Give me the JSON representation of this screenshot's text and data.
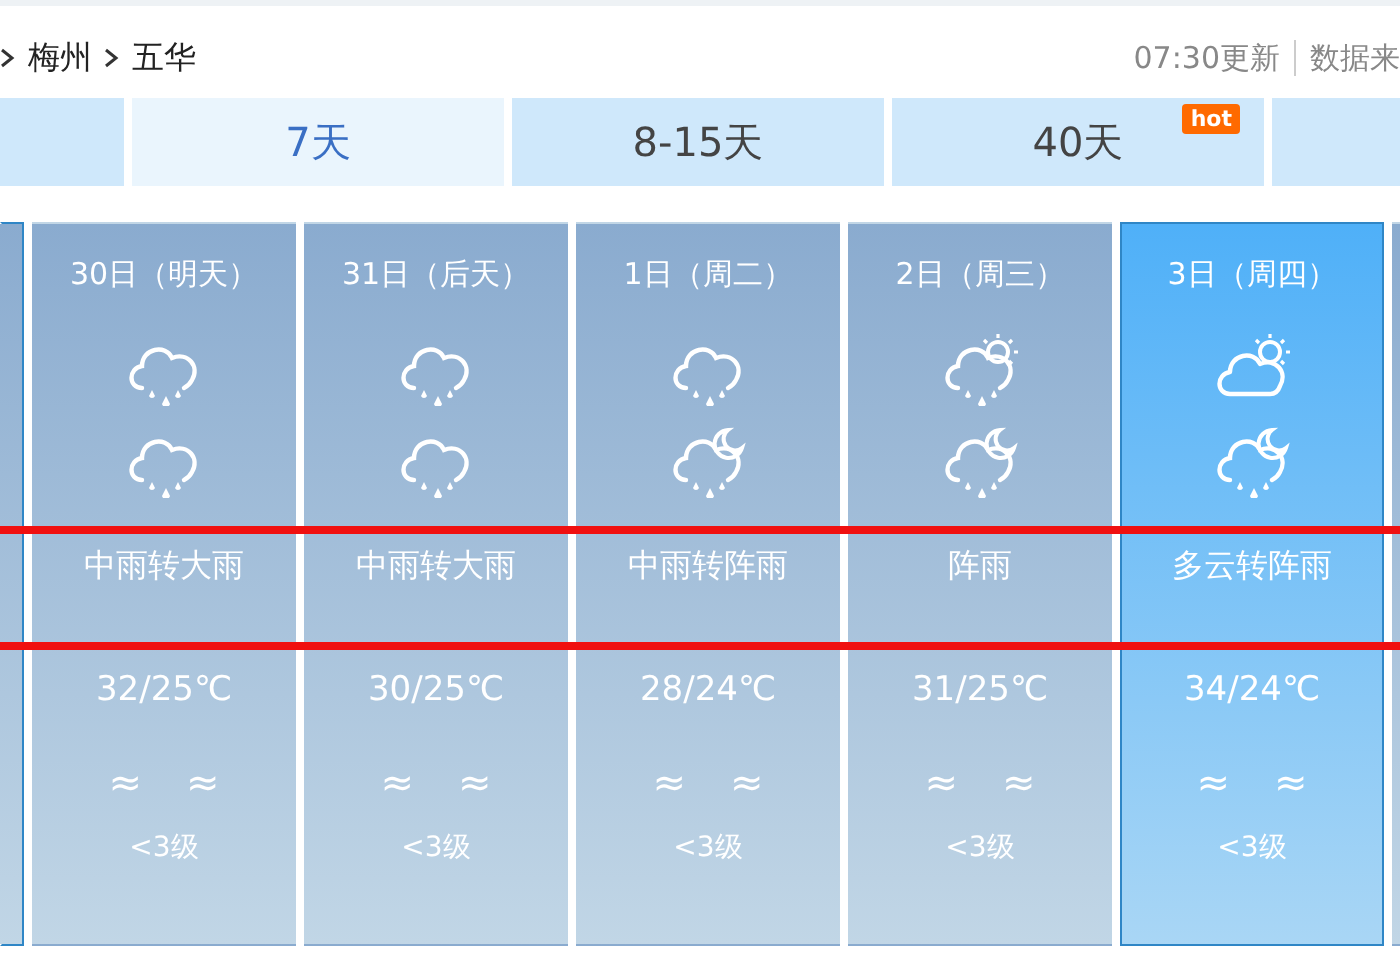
{
  "breadcrumb": [
    {
      "label": "梅州"
    },
    {
      "label": "五华"
    }
  ],
  "update_time": "07:30更新",
  "data_source": "数据来",
  "tabs": [
    {
      "selected": false
    },
    {
      "label": "7天",
      "selected": true
    },
    {
      "label": "8-15天",
      "selected": false
    },
    {
      "label": "40天",
      "selected": false,
      "badge": "hot"
    },
    {
      "selected": false
    }
  ],
  "days": [
    {
      "date": "30日（明天）",
      "day_icon": {
        "kind": "rain"
      },
      "night_icon": {
        "kind": "rain"
      },
      "weather": "中雨转大雨",
      "temp": "32/25℃",
      "wind": [
        "≈",
        "≈"
      ],
      "wind_level": "<3级",
      "selected": false
    },
    {
      "date": "31日（后天）",
      "day_icon": {
        "kind": "rain"
      },
      "night_icon": {
        "kind": "rain"
      },
      "weather": "中雨转大雨",
      "temp": "30/25℃",
      "wind": [
        "≈",
        "≈"
      ],
      "wind_level": "<3级",
      "selected": false
    },
    {
      "date": "1日（周二）",
      "day_icon": {
        "kind": "rain"
      },
      "night_icon": {
        "kind": "shower-night"
      },
      "weather": "中雨转阵雨",
      "temp": "28/24℃",
      "wind": [
        "≈",
        "≈"
      ],
      "wind_level": "<3级",
      "selected": false
    },
    {
      "date": "2日（周三）",
      "day_icon": {
        "kind": "shower-day"
      },
      "night_icon": {
        "kind": "shower-night"
      },
      "weather": "阵雨",
      "temp": "31/25℃",
      "wind": [
        "≈",
        "≈"
      ],
      "wind_level": "<3级",
      "selected": false
    },
    {
      "date": "3日（周四）",
      "day_icon": {
        "kind": "partly-cloudy"
      },
      "night_icon": {
        "kind": "shower-night"
      },
      "weather": "多云转阵雨",
      "temp": "34/24℃",
      "wind": [
        "≈",
        "≈"
      ],
      "wind_level": "<3级",
      "selected": true
    }
  ]
}
